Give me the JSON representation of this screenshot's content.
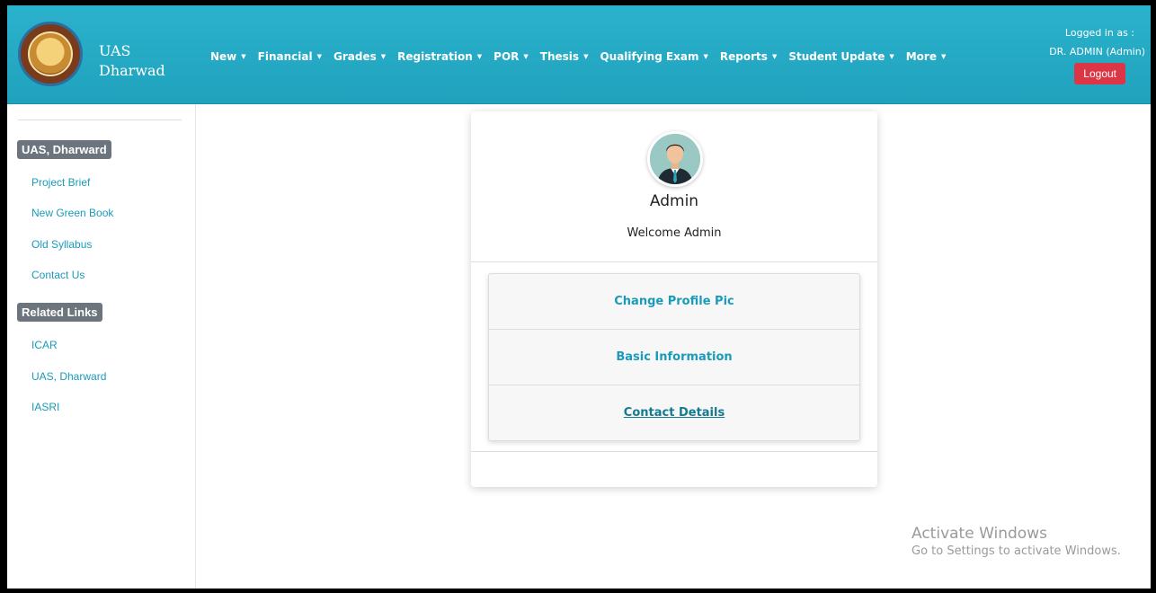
{
  "header": {
    "brand_line1": "UAS",
    "brand_line2": "Dharwad",
    "nav": [
      {
        "label": "New"
      },
      {
        "label": "Financial"
      },
      {
        "label": "Grades"
      },
      {
        "label": "Registration"
      },
      {
        "label": "POR"
      },
      {
        "label": "Thesis"
      },
      {
        "label": "Qualifying Exam"
      },
      {
        "label": "Reports"
      },
      {
        "label": "Student Update"
      },
      {
        "label": "More"
      }
    ],
    "logged_in_label": "Logged in as :",
    "user": "DR. ADMIN (Admin)",
    "logout": "Logout"
  },
  "sidebar": {
    "section1": "UAS, Dharward",
    "links1": [
      "Project Brief",
      "New Green Book",
      "Old Syllabus",
      "Contact Us"
    ],
    "section2": "Related Links",
    "links2": [
      "ICAR",
      "UAS, Dharward",
      "IASRI"
    ]
  },
  "card": {
    "name": "Admin",
    "welcome": "Welcome Admin",
    "menu": [
      "Change Profile Pic",
      "Basic Information",
      "Contact Details"
    ]
  },
  "watermark": {
    "line1": "Activate Windows",
    "line2": "Go to Settings to activate Windows."
  },
  "colors": {
    "header": "#20a2bd",
    "link": "#1a9bb9",
    "logout": "#dc3545",
    "badge": "#6c757d"
  }
}
